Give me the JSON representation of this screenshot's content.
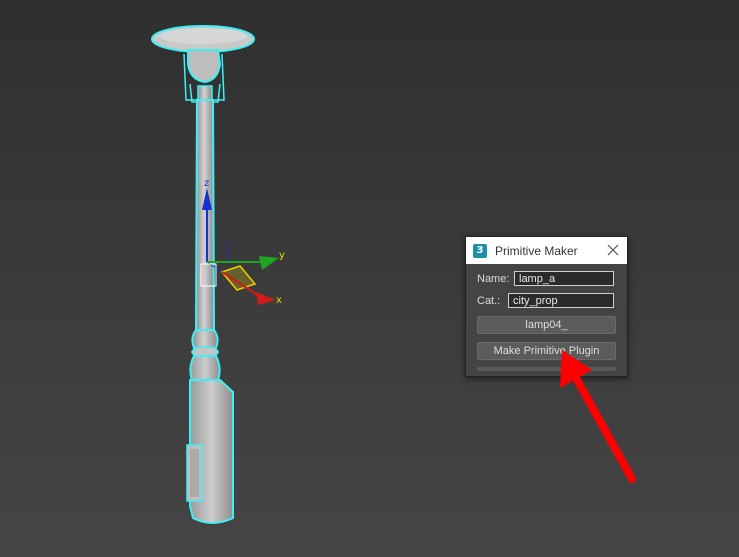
{
  "dialog": {
    "title": "Primitive Maker",
    "app_icon": "3ds-max-icon",
    "name_label": "Name:",
    "name_value": "lamp_a",
    "category_label": "Cat.:",
    "category_value": "city_prop",
    "object_button_label": "lamp04_",
    "make_button_label": "Make Primitive Plugin",
    "progress": 0
  },
  "gizmo": {
    "x_label": "x",
    "y_label": "y",
    "z_label": "z"
  },
  "colors": {
    "selection_outline": "#3ef0f5",
    "lamp_body": "#b9b9b9",
    "axis_x": "#d11a1a",
    "axis_y": "#1fa51f",
    "axis_z": "#1a2fd1",
    "arrow": "#ff0000"
  },
  "icons": {
    "close": "close-icon",
    "annotation_arrow": "red-arrow-icon"
  }
}
